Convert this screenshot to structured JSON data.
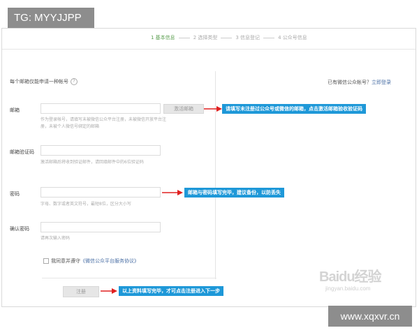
{
  "overlay": {
    "tg_label": "TG: MYYJJPP",
    "site_label": "www.xqxvr.cn"
  },
  "steps": [
    {
      "label": "1 基本信息",
      "active": true
    },
    {
      "label": "2 选择类型",
      "active": false
    },
    {
      "label": "3 信息登记",
      "active": false
    },
    {
      "label": "4 公众号信息",
      "active": false
    }
  ],
  "form": {
    "note": "每个邮箱仅能申请一种帐号",
    "login_hint_text": "已有微信公众帐号？",
    "login_link": "立即登录",
    "email": {
      "label": "邮箱",
      "value": "",
      "hint": "作为登录帐号，请填写未被微信公众平台注册，未被微信开放平台注册，未被个人微信号绑定的邮箱",
      "activate_button": "激活邮箱"
    },
    "code": {
      "label": "邮箱验证码",
      "value": "",
      "hint": "激活邮箱后将收到验证邮件，请回填邮件中的6位验证码"
    },
    "password": {
      "label": "密码",
      "value": "",
      "hint": "字母、数字或者英文符号，最短8位，区分大小写"
    },
    "confirm": {
      "label": "确认密码",
      "value": "",
      "hint": "请再次输入密码"
    },
    "agree_text": "我同意并遵守",
    "agreement_link": "《微信公众平台服务协议》",
    "agree_checked": false,
    "register_button": "注册"
  },
  "callouts": {
    "email": "请填写未注册过公众号或微信的邮箱，点击激活邮箱验收验证码",
    "password": "邮箱与密码填写完毕，建议备份，以防丢失",
    "register": "以上资料填写完毕，才可点击注册进入下一步"
  },
  "watermark": {
    "logo": "Baidu经验",
    "sub": "jingyan.baidu.com"
  },
  "colors": {
    "callout_bg": "#1e98d8",
    "arrow": "#e02020",
    "step_active": "#5a9e4f"
  }
}
